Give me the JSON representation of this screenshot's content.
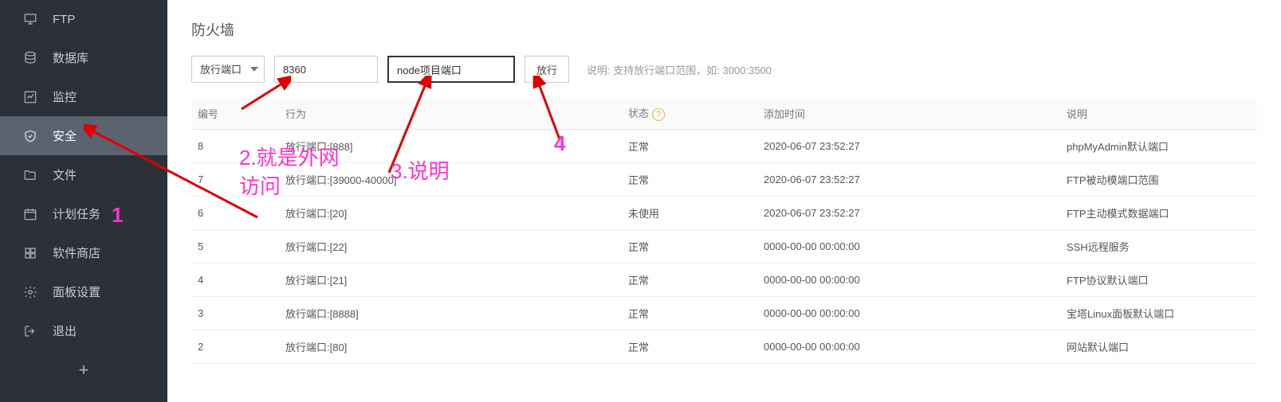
{
  "sidebar": {
    "items": [
      {
        "label": "FTP",
        "icon": "ftp-icon"
      },
      {
        "label": "数据库",
        "icon": "database-icon"
      },
      {
        "label": "监控",
        "icon": "monitor-icon"
      },
      {
        "label": "安全",
        "icon": "shield-icon",
        "active": true
      },
      {
        "label": "文件",
        "icon": "folder-icon"
      },
      {
        "label": "计划任务",
        "icon": "calendar-icon"
      },
      {
        "label": "软件商店",
        "icon": "apps-icon"
      },
      {
        "label": "面板设置",
        "icon": "gear-icon"
      },
      {
        "label": "退出",
        "icon": "logout-icon"
      }
    ]
  },
  "page_title": "防火墙",
  "toolbar": {
    "select_label": "放行端口",
    "port_value": "8360",
    "desc_value": "node项目端口",
    "desc_placeholder": "",
    "open_label": "放行",
    "hint": "说明: 支持放行端口范围，如: 3000:3500"
  },
  "table": {
    "headers": {
      "id": "编号",
      "action": "行为",
      "status": "状态",
      "time": "添加时间",
      "desc": "说明"
    },
    "rows": [
      {
        "id": "8",
        "action": "放行端口:[888]",
        "status": "正常",
        "time": "2020-06-07 23:52:27",
        "desc": "phpMyAdmin默认端口"
      },
      {
        "id": "7",
        "action": "放行端口:[39000-40000]",
        "status": "正常",
        "time": "2020-06-07 23:52:27",
        "desc": "FTP被动模端口范围"
      },
      {
        "id": "6",
        "action": "放行端口:[20]",
        "status": "未使用",
        "time": "2020-06-07 23:52:27",
        "desc": "FTP主动模式数据端口"
      },
      {
        "id": "5",
        "action": "放行端口:[22]",
        "status": "正常",
        "time": "0000-00-00 00:00:00",
        "desc": "SSH远程服务"
      },
      {
        "id": "4",
        "action": "放行端口:[21]",
        "status": "正常",
        "time": "0000-00-00 00:00:00",
        "desc": "FTP协议默认端口"
      },
      {
        "id": "3",
        "action": "放行端口:[8888]",
        "status": "正常",
        "time": "0000-00-00 00:00:00",
        "desc": "宝塔Linux面板默认端口"
      },
      {
        "id": "2",
        "action": "放行端口:[80]",
        "status": "正常",
        "time": "0000-00-00 00:00:00",
        "desc": "网站默认端口"
      }
    ]
  },
  "annotations": {
    "a1": "1",
    "a2": "2.就是外网访问",
    "a2_l1": "2.就是外网",
    "a2_l2": "访问",
    "a3": "3.说明",
    "a4": "4"
  }
}
